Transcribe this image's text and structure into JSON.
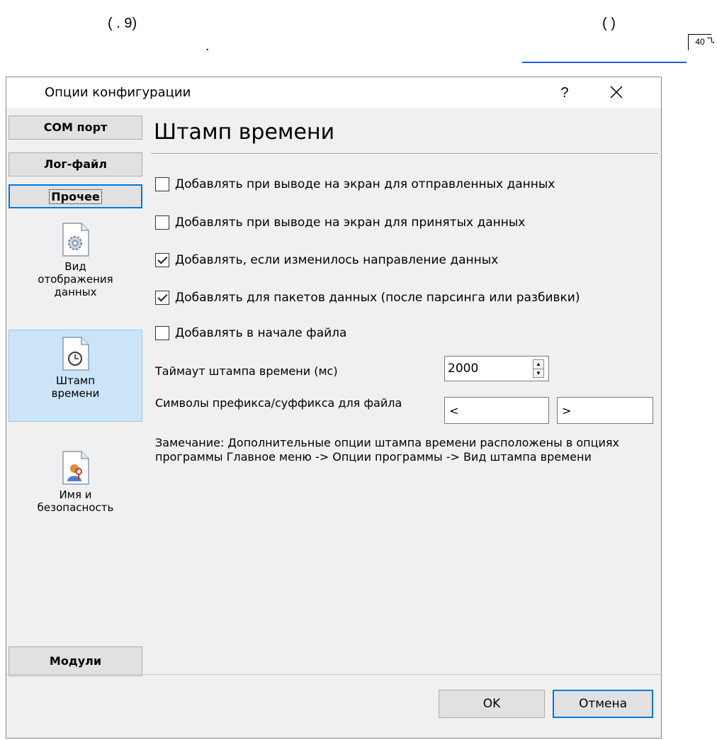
{
  "doc": {
    "fragment1": "(    . 9)",
    "fragment2": ".",
    "fragment3": "(           )",
    "ref_number": "40"
  },
  "dialog": {
    "title": "Опции конфигурации",
    "help": "?",
    "sidebar": {
      "buttons": [
        "COM порт",
        "Лог-файл",
        "Прочее"
      ],
      "items": [
        "Вид\nотображения\nданных",
        "Штамп\nвремени",
        "Имя и\nбезопасность"
      ],
      "modules": "Модули"
    },
    "panel": {
      "title": "Штамп времени",
      "checkboxes": [
        {
          "label": "Добавлять при выводе на экран для отправленных данных",
          "checked": false
        },
        {
          "label": "Добавлять при выводе на экран для принятых данных",
          "checked": false
        },
        {
          "label": "Добавлять, если изменилось направление данных",
          "checked": true
        },
        {
          "label": "Добавлять для пакетов данных (после парсинга или разбивки)",
          "checked": true
        },
        {
          "label": "Добавлять в начале файла",
          "checked": false
        }
      ],
      "timeout_label": "Таймаут штампа времени (мс)",
      "timeout_value": "2000",
      "prefix_label": "Символы префикса/суффикса для файла",
      "prefix_value": "<",
      "suffix_value": ">",
      "note": "Замечание: Дополнительные опции штампа времени расположены в опциях программы Главное меню -> Опции программы -> Вид штампа времени"
    },
    "ok": "OK",
    "cancel": "Отмена"
  },
  "colors": {
    "accent": "#0078d7",
    "selection": "#cce4f7",
    "link": "#1e5fd6"
  }
}
